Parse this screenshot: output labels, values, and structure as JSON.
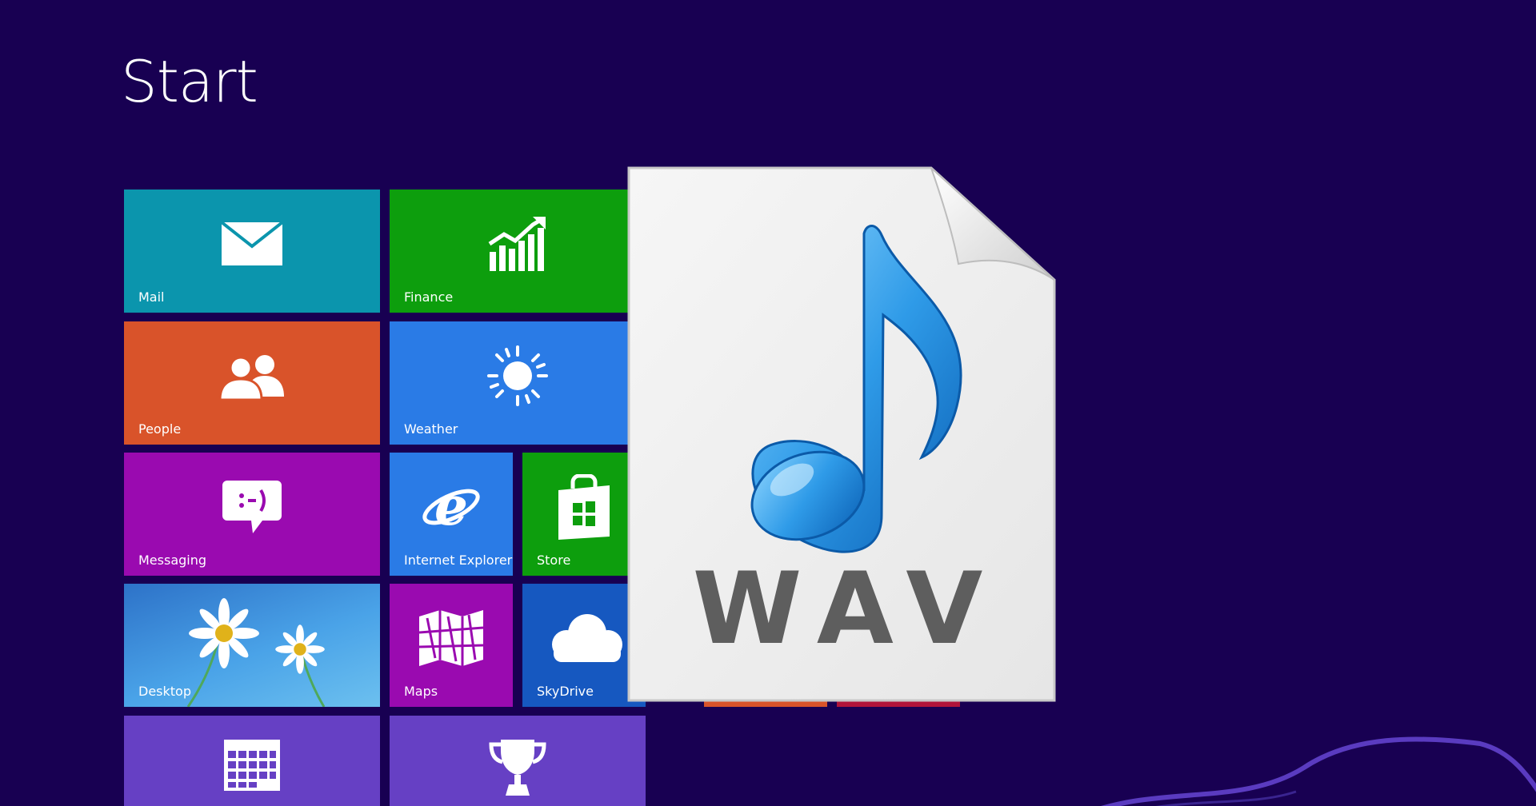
{
  "start": {
    "title": "Start"
  },
  "tiles": {
    "mail": {
      "label": "Mail",
      "icon": "mail-icon",
      "color": "#0b95ad"
    },
    "finance": {
      "label": "Finance",
      "icon": "finance-chart-icon",
      "color": "#0d9e0d"
    },
    "people": {
      "label": "People",
      "icon": "people-icon",
      "color": "#d9532a"
    },
    "weather": {
      "label": "Weather",
      "icon": "sun-icon",
      "color": "#2a7be6"
    },
    "messaging": {
      "label": "Messaging",
      "icon": "messaging-icon",
      "color": "#9a0ab0"
    },
    "internet_explorer": {
      "label": "Internet Explorer",
      "icon": "internet-explorer-icon",
      "color": "#2a7be6"
    },
    "store": {
      "label": "Store",
      "icon": "store-bag-icon",
      "color": "#0d9e0d"
    },
    "desktop": {
      "label": "Desktop",
      "icon": "daisy-wallpaper",
      "color": "#3a8fd8"
    },
    "maps": {
      "label": "Maps",
      "icon": "map-icon",
      "color": "#9a0ab0"
    },
    "skydrive": {
      "label": "SkyDrive",
      "icon": "cloud-icon",
      "color": "#1658c0"
    },
    "calendar": {
      "label": "",
      "icon": "calendar-icon",
      "color": "#6640c4"
    },
    "games": {
      "label": "",
      "icon": "trophy-icon",
      "color": "#6640c4"
    }
  },
  "overlay": {
    "file_type": "WAV",
    "icon": "music-note-icon"
  }
}
